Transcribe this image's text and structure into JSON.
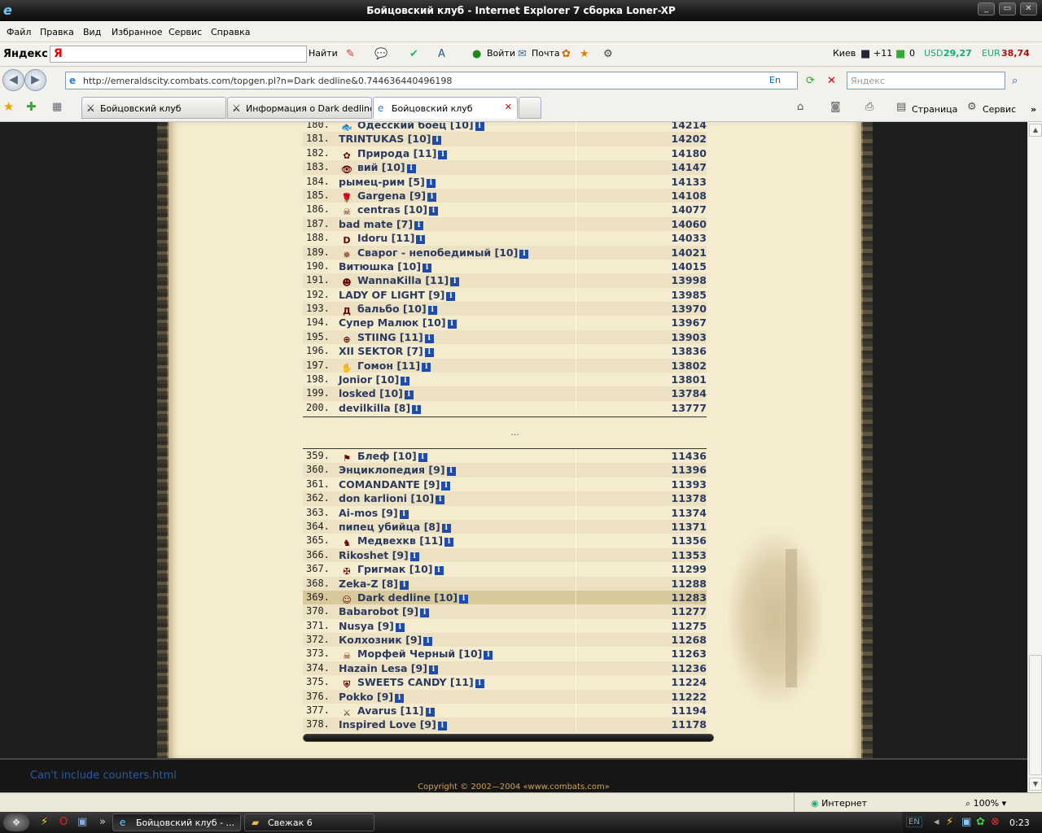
{
  "window": {
    "title": "Бойцовский клуб - Internet Explorer 7 сборка Loner-XP"
  },
  "menu": [
    "Файл",
    "Правка",
    "Вид",
    "Избранное",
    "Сервис",
    "Справка"
  ],
  "yandex": {
    "logo": "Яндекс",
    "find": "Найти",
    "login": "Войти",
    "mail": "Почта",
    "city": "Киев",
    "temp": "+11",
    "mail_count": "0",
    "usd_label": "USD",
    "usd": "29,27",
    "eur_label": "EUR",
    "eur": "38,74"
  },
  "address": {
    "url": "http://emeraldscity.combats.com/topgen.pl?n=Dark dedline&0.744636440496198",
    "lang": "En",
    "search_placeholder": "Яндекс"
  },
  "tabs": [
    {
      "label": "Бойцовский клуб"
    },
    {
      "label": "Информация о Dark dedline"
    },
    {
      "label": "Бойцовский клуб"
    }
  ],
  "toolbar_right": {
    "page": "Страница",
    "service": "Сервис"
  },
  "ranking_top": [
    {
      "num": "180.",
      "name": "Одесский боец [10]",
      "score": "14214",
      "emblem": "🐟"
    },
    {
      "num": "181.",
      "name": "TRINTUKAS [10]",
      "score": "14202"
    },
    {
      "num": "182.",
      "name": "Природа [11]",
      "score": "14180",
      "emblem": "✿"
    },
    {
      "num": "183.",
      "name": "вий [10]",
      "score": "14147",
      "emblem": "👁"
    },
    {
      "num": "184.",
      "name": "рымец-рим [5]",
      "score": "14133"
    },
    {
      "num": "185.",
      "name": "Gargena [9]",
      "score": "14108",
      "emblem": "🌹"
    },
    {
      "num": "186.",
      "name": "centras [10]",
      "score": "14077",
      "emblem": "☠"
    },
    {
      "num": "187.",
      "name": "bad mate [7]",
      "score": "14060"
    },
    {
      "num": "188.",
      "name": "Idoru [11]",
      "score": "14033",
      "emblem": "D"
    },
    {
      "num": "189.",
      "name": "Сварог - непобедимый [10]",
      "score": "14021",
      "emblem": "✵"
    },
    {
      "num": "190.",
      "name": "Витюшка [10]",
      "score": "14015"
    },
    {
      "num": "191.",
      "name": "WannaKilla [11]",
      "score": "13998",
      "emblem": "☻"
    },
    {
      "num": "192.",
      "name": "LADY OF LIGHT [9]",
      "score": "13985"
    },
    {
      "num": "193.",
      "name": "бальбо [10]",
      "score": "13970",
      "emblem": "Д"
    },
    {
      "num": "194.",
      "name": "Супер Малюк [10]",
      "score": "13967"
    },
    {
      "num": "195.",
      "name": "STIING [11]",
      "score": "13903",
      "emblem": "⊕"
    },
    {
      "num": "196.",
      "name": "XII SEKTOR [7]",
      "score": "13836"
    },
    {
      "num": "197.",
      "name": "Гомон [11]",
      "score": "13802",
      "emblem": "✋"
    },
    {
      "num": "198.",
      "name": "Jonior [10]",
      "score": "13801"
    },
    {
      "num": "199.",
      "name": "losked [10]",
      "score": "13784"
    },
    {
      "num": "200.",
      "name": "devilkilla [8]",
      "score": "13777"
    }
  ],
  "ellipsis": "...",
  "ranking_bottom": [
    {
      "num": "359.",
      "name": "Блеф [10]",
      "score": "11436",
      "emblem": "⚑"
    },
    {
      "num": "360.",
      "name": "Энциклопедия [9]",
      "score": "11396"
    },
    {
      "num": "361.",
      "name": "COMANDANTE [9]",
      "score": "11393"
    },
    {
      "num": "362.",
      "name": "don karlioni [10]",
      "score": "11378"
    },
    {
      "num": "363.",
      "name": "Ai-mos [9]",
      "score": "11374"
    },
    {
      "num": "364.",
      "name": "пипец убийца [8]",
      "score": "11371"
    },
    {
      "num": "365.",
      "name": "Медвехкв [11]",
      "score": "11356",
      "emblem": "♞"
    },
    {
      "num": "366.",
      "name": "Rikoshet [9]",
      "score": "11353"
    },
    {
      "num": "367.",
      "name": "Григмак [10]",
      "score": "11299",
      "emblem": "✠"
    },
    {
      "num": "368.",
      "name": "Zeka-Z [8]",
      "score": "11288"
    },
    {
      "num": "369.",
      "name": "Dark dedline [10]",
      "score": "11283",
      "emblem": "☺",
      "me": true
    },
    {
      "num": "370.",
      "name": "Babarobot [9]",
      "score": "11277"
    },
    {
      "num": "371.",
      "name": "Nusya [9]",
      "score": "11275"
    },
    {
      "num": "372.",
      "name": "Колхозник [9]",
      "score": "11268"
    },
    {
      "num": "373.",
      "name": "Морфей Черный [10]",
      "score": "11263",
      "emblem": "☠"
    },
    {
      "num": "374.",
      "name": "Hazain Lesa [9]",
      "score": "11236"
    },
    {
      "num": "375.",
      "name": "SWEETS CANDY [11]",
      "score": "11224",
      "emblem": "⛨"
    },
    {
      "num": "376.",
      "name": "Pokko [9]",
      "score": "11222"
    },
    {
      "num": "377.",
      "name": "Avarus [11]",
      "score": "11194",
      "emblem": "⚔"
    },
    {
      "num": "378.",
      "name": "Inspired Love [9]",
      "score": "11178"
    }
  ],
  "footer": {
    "cant": "Can't include counters.html",
    "copyright": "Copyright © 2002—2004 «www.combats.com»"
  },
  "status": {
    "zone": "Интернет",
    "zoom": "100%"
  },
  "taskbar": {
    "items": [
      {
        "label": "Бойцовский клуб - ..."
      },
      {
        "label": "Свежак 6"
      }
    ],
    "lang": "EN",
    "clock": "0:23"
  }
}
